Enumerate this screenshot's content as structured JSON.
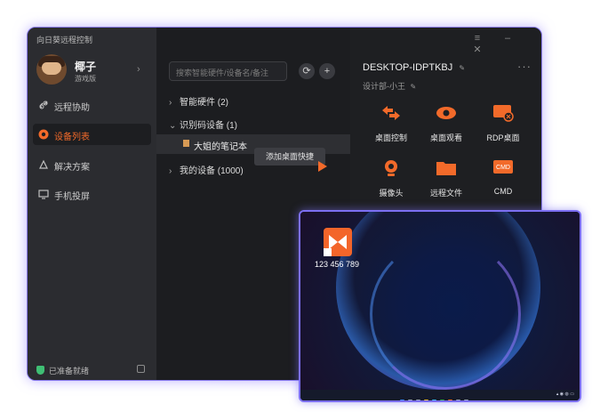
{
  "app": {
    "title": "向日葵远程控制"
  },
  "user": {
    "name": "椰子",
    "plan": "游戏版"
  },
  "sidebar": {
    "items": [
      {
        "label": "远程协助",
        "icon": "link-icon"
      },
      {
        "label": "设备列表",
        "icon": "device-list-icon",
        "active": true
      },
      {
        "label": "解决方案",
        "icon": "solution-icon"
      },
      {
        "label": "手机投屏",
        "icon": "screen-cast-icon"
      }
    ],
    "status": "已准备就绪"
  },
  "middle": {
    "search_placeholder": "搜索智能硬件/设备名/备注",
    "tree": [
      {
        "label": "智能硬件 (2)",
        "expanded": false
      },
      {
        "label": "识别码设备 (1)",
        "expanded": true
      },
      {
        "label": "我的设备 (1000)",
        "expanded": false
      }
    ],
    "selected_device": "大姐的笔记本",
    "tooltip": "添加桌面快捷"
  },
  "device": {
    "name": "DESKTOP-IDPTKBJ",
    "sub": "设计部-小王",
    "actions": [
      {
        "label": "桌面控制",
        "icon": "desktop-control-icon"
      },
      {
        "label": "桌面观看",
        "icon": "eye-icon"
      },
      {
        "label": "RDP桌面",
        "icon": "rdp-icon"
      },
      {
        "label": "摄像头",
        "icon": "camera-icon"
      },
      {
        "label": "远程文件",
        "icon": "folder-icon"
      },
      {
        "label": "CMD",
        "icon": "cmd-icon"
      }
    ]
  },
  "preview": {
    "shortcut_label": "123 456 789"
  },
  "colors": {
    "accent": "#f26a2a",
    "border": "#8a7cf0",
    "status": "#3fbf74"
  }
}
